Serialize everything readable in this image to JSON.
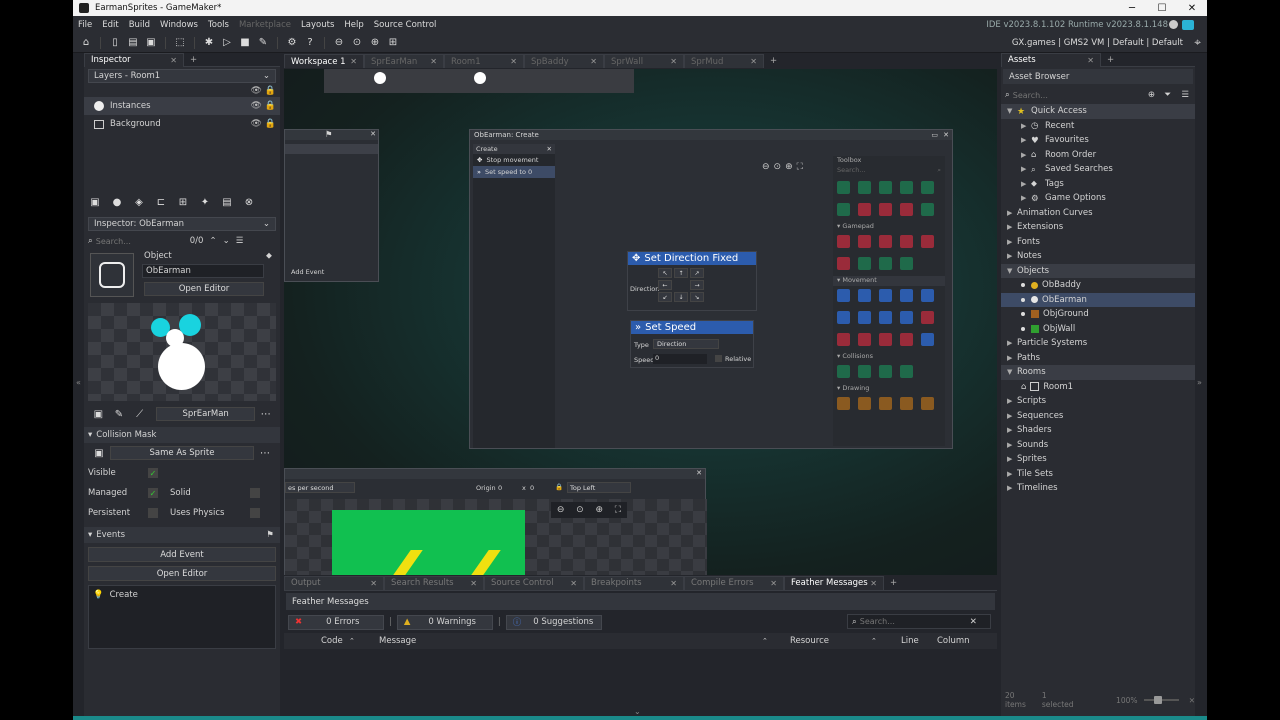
{
  "titlebar": {
    "title": "EarmanSprites - GameMaker*",
    "min": "─",
    "max": "☐",
    "close": "✕"
  },
  "menu": {
    "items": [
      "File",
      "Edit",
      "Build",
      "Windows",
      "Tools"
    ],
    "disabled": "Marketplace",
    "items2": [
      "Layouts",
      "Help",
      "Source Control"
    ],
    "version": "IDE v2023.8.1.102 Runtime v2023.8.1.148"
  },
  "toolbar": {
    "target": "GX.games | GMS2 VM | Default | Default"
  },
  "inspector": {
    "tab": "Inspector",
    "layers_dropdown": "Layers - Room1",
    "layers": [
      "Instances",
      "Background"
    ],
    "inspector_dropdown": "Inspector: ObEarman",
    "search_placeholder": "Search...",
    "search_count": "0/0",
    "object_label": "Object",
    "object_name": "ObEarman",
    "open_editor": "Open Editor",
    "sprite_name": "SprEarMan",
    "collision_mask": "Collision Mask",
    "same_as_sprite": "Same As Sprite",
    "visible": "Visible",
    "managed": "Managed",
    "solid": "Solid",
    "persistent": "Persistent",
    "uses_physics": "Uses Physics",
    "events": "Events",
    "add_event": "Add Event",
    "open_editor2": "Open Editor",
    "create_event": "Create"
  },
  "workspace": {
    "tabs": [
      "Workspace 1",
      "SprEarMan",
      "Room1",
      "SpBaddy",
      "SprWall",
      "SprMud"
    ],
    "add_event": "Add Event",
    "create_window": {
      "title": "ObEarman: Create",
      "tab": "Create",
      "actions": [
        "Stop movement",
        "Set speed to 0"
      ]
    },
    "node1": {
      "title": "Set Direction Fixed",
      "label": "Direction"
    },
    "node2": {
      "title": "Set Speed",
      "type_label": "Type",
      "type_value": "Direction",
      "speed_label": "Speed",
      "speed_value": "0",
      "relative": "Relative"
    },
    "toolbox": {
      "title": "Toolbox",
      "search": "Search...",
      "sections": [
        "Gamepad",
        "Movement",
        "Collisions",
        "Drawing"
      ]
    },
    "sprite_editor": {
      "fps": "es per second",
      "origin_label": "Origin",
      "origin_x": "0",
      "x_label": "x",
      "origin_y": "0",
      "origin_pos": "Top Left"
    }
  },
  "bottom": {
    "tabs": [
      "Output",
      "Search Results",
      "Source Control",
      "Breakpoints",
      "Compile Errors",
      "Feather Messages"
    ],
    "header": "Feather Messages",
    "errors": "0 Errors",
    "warnings": "0 Warnings",
    "suggestions": "0 Suggestions",
    "search_placeholder": "Search...",
    "columns": [
      "Code",
      "Message",
      "Resource",
      "Line",
      "Column"
    ]
  },
  "assets": {
    "tab": "Assets",
    "browser": "Asset Browser",
    "search_placeholder": "Search...",
    "quick_access": "Quick Access",
    "quick_items": [
      "Recent",
      "Favourites",
      "Room Order",
      "Saved Searches",
      "Tags",
      "Game Options"
    ],
    "groups1": [
      "Animation Curves",
      "Extensions",
      "Fonts",
      "Notes"
    ],
    "objects": "Objects",
    "object_items": [
      "ObBaddy",
      "ObEarman",
      "ObjGround",
      "ObjWall"
    ],
    "groups2": [
      "Particle Systems",
      "Paths"
    ],
    "rooms": "Rooms",
    "room_items": [
      "Room1"
    ],
    "groups3": [
      "Scripts",
      "Sequences",
      "Shaders",
      "Sounds",
      "Sprites",
      "Tile Sets",
      "Timelines"
    ],
    "status_items": "20 items",
    "status_selected": "1 selected",
    "zoom": "100%",
    "colors": {
      "obbaddy": "#e0b020",
      "obearman": "#e6e6e6",
      "objground": "#a06020",
      "objwall": "#30a030"
    }
  }
}
